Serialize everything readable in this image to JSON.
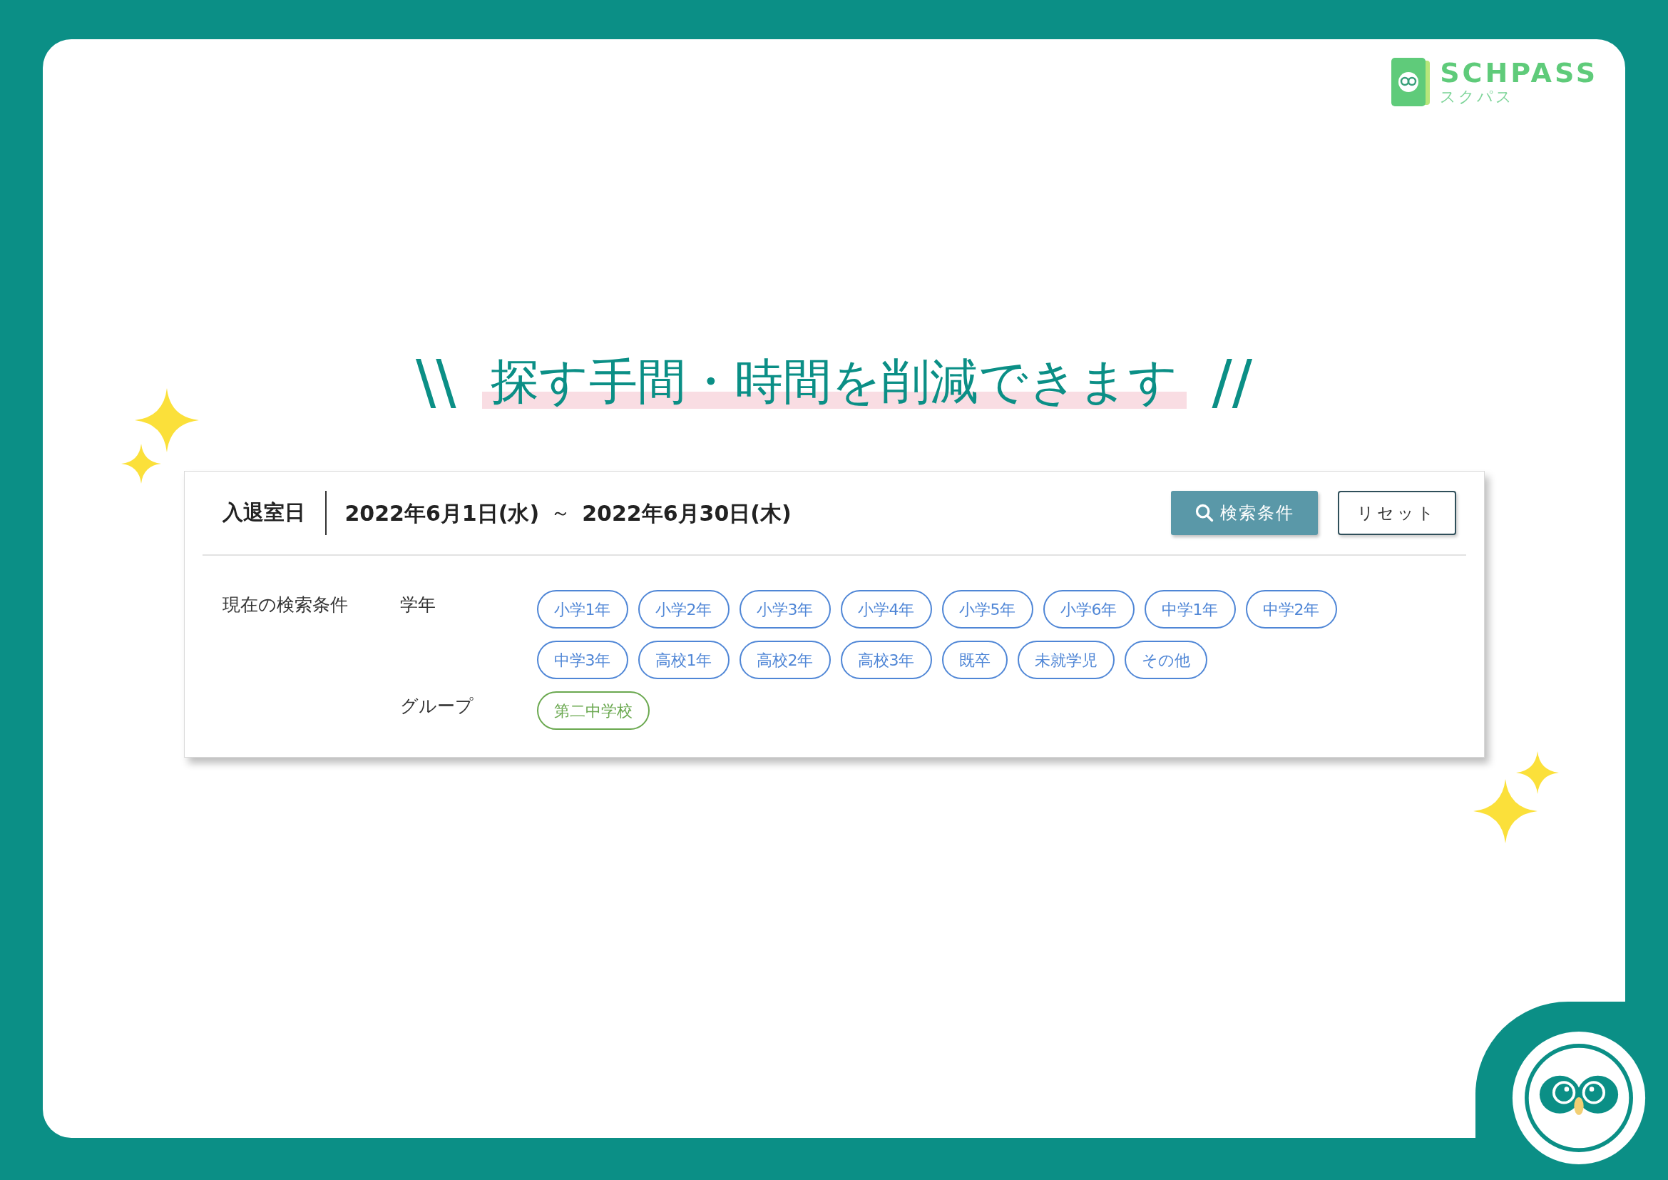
{
  "logo": {
    "name": "SCHPASS",
    "kana": "スクパス"
  },
  "headline": {
    "left_mark": "\\\\",
    "text": "探す手間・時間を削減できます",
    "right_mark": "//"
  },
  "panel": {
    "date_label": "入退室日",
    "date_from": "2022年6月1日(水)",
    "separator": "～",
    "date_to": "2022年6月30日(木)",
    "search_button": "検索条件",
    "reset_button": "リセット",
    "conditions_label": "現在の検索条件",
    "filters": [
      {
        "label": "学年",
        "kind": "grade",
        "tags": [
          "小学1年",
          "小学2年",
          "小学3年",
          "小学4年",
          "小学5年",
          "小学6年",
          "中学1年",
          "中学2年",
          "中学3年",
          "高校1年",
          "高校2年",
          "高校3年",
          "既卒",
          "未就学児",
          "その他"
        ]
      },
      {
        "label": "グループ",
        "kind": "group",
        "tags": [
          "第二中学校"
        ]
      }
    ]
  }
}
